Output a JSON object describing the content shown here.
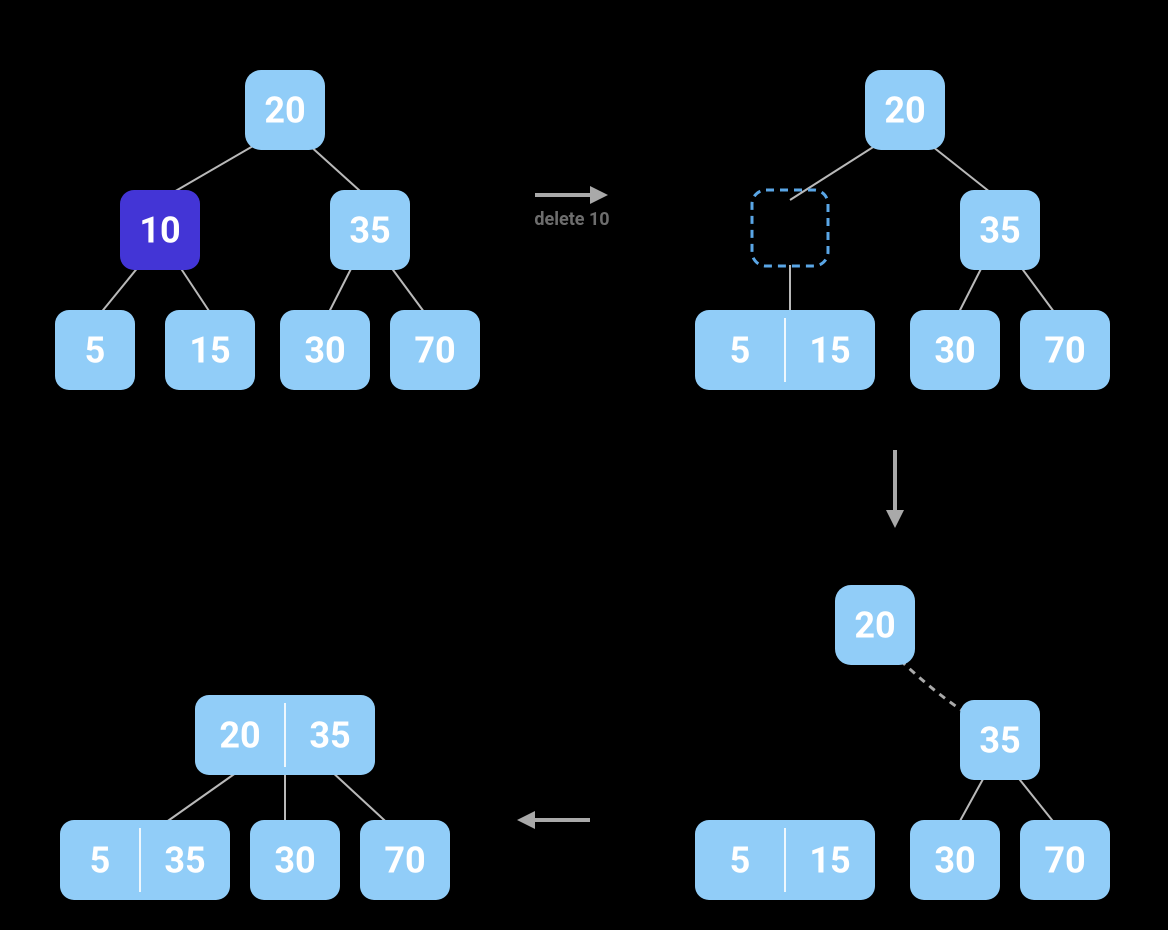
{
  "caption": "delete 10",
  "step1": {
    "root": "20",
    "left": "10",
    "right": "35",
    "leaves": [
      "5",
      "15",
      "30",
      "70"
    ]
  },
  "step2": {
    "root": "20",
    "right": "35",
    "mergedLeft": [
      "5",
      "15"
    ],
    "leaves": [
      "30",
      "70"
    ]
  },
  "step3": {
    "root": "20",
    "right": "35",
    "mergedLeft": [
      "5",
      "15"
    ],
    "leaves": [
      "30",
      "70"
    ]
  },
  "step4": {
    "root": [
      "20",
      "35"
    ],
    "leftMerged": [
      "5",
      "35"
    ],
    "leaves": [
      "30",
      "70"
    ]
  }
}
